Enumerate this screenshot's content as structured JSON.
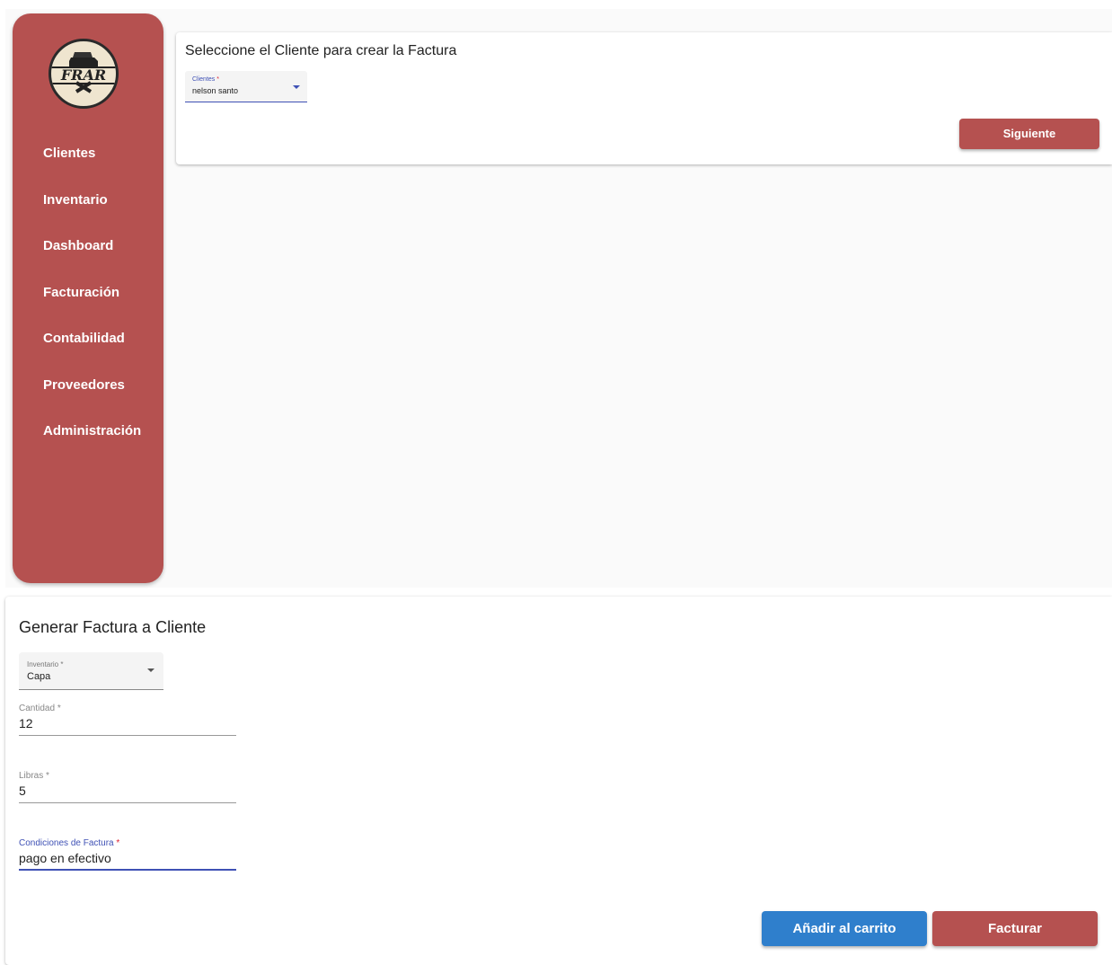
{
  "sidebar": {
    "logo_text": "FRAR",
    "items": [
      {
        "label": "Clientes"
      },
      {
        "label": "Inventario"
      },
      {
        "label": "Dashboard"
      },
      {
        "label": "Facturación"
      },
      {
        "label": "Contabilidad"
      },
      {
        "label": "Proveedores"
      },
      {
        "label": "Administración"
      }
    ]
  },
  "client_card": {
    "title": "Seleccione el Cliente para crear la Factura",
    "client_select": {
      "label": "Clientes",
      "required_mark": "*",
      "value": "nelson santo"
    },
    "next_button": "Siguiente"
  },
  "invoice_card": {
    "title": "Generar Factura a Cliente",
    "inventory_select": {
      "label": "Inventario",
      "required_mark": "*",
      "value": "Capa"
    },
    "quantity": {
      "label": "Cantidad",
      "required_mark": "*",
      "value": "12"
    },
    "pounds": {
      "label": "Libras",
      "required_mark": "*",
      "value": "5"
    },
    "conditions": {
      "label": "Condiciones de Factura",
      "required_mark": "*",
      "value": "pago en efectivo"
    },
    "add_to_cart_button": "Añadir al carrito",
    "invoice_button": "Facturar"
  },
  "colors": {
    "sidebar": "#b55150",
    "primary_red": "#b55150",
    "primary_blue": "#2f7fcc",
    "focus": "#3f51b5"
  }
}
